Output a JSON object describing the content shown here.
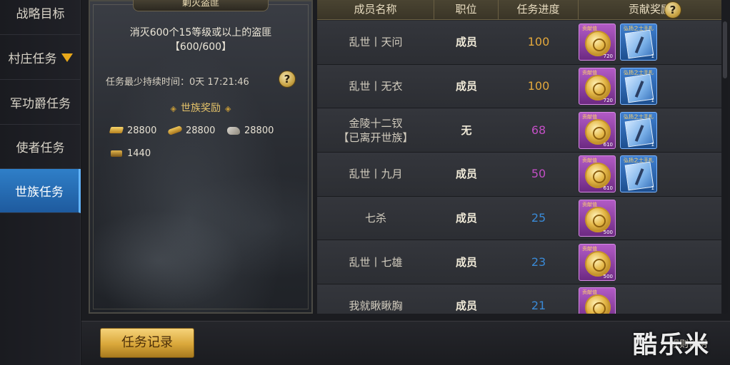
{
  "sidebar": {
    "items": [
      {
        "label": "战略目标",
        "active": false
      },
      {
        "label": "村庄任务",
        "active": false,
        "has_alert": true
      },
      {
        "label": "军功爵任务",
        "active": false
      },
      {
        "label": "使者任务",
        "active": false
      },
      {
        "label": "世族任务",
        "active": true
      }
    ]
  },
  "task": {
    "title": "剿灭盗匪",
    "description": "消灭600个15等级或以上的盗匪",
    "progress": "【600/600】",
    "duration_label": "任务最少持续时间：0天 17:21:46",
    "help_icon": "?",
    "reward_title": "世族奖励",
    "rewards": [
      {
        "icon": "gold-bars-icon",
        "amount": "28800"
      },
      {
        "icon": "wood-icon",
        "amount": "28800"
      },
      {
        "icon": "stone-icon",
        "amount": "28800"
      },
      {
        "icon": "iron-icon",
        "amount": "1440"
      }
    ]
  },
  "table": {
    "headers": [
      "成员名称",
      "职位",
      "任务进度",
      "贡献奖励"
    ],
    "help_icon": "?",
    "rows": [
      {
        "name": "乱世丨天问",
        "position": "成员",
        "progress": "100",
        "progress_color": "#e3a83c",
        "rewards": [
          {
            "type": "coin",
            "tag": "贡献值",
            "qty": "720"
          },
          {
            "type": "book",
            "tag": "弘扬之士手札",
            "qty": "1"
          }
        ]
      },
      {
        "name": "乱世丨无衣",
        "position": "成员",
        "progress": "100",
        "progress_color": "#e3a83c",
        "rewards": [
          {
            "type": "coin",
            "tag": "贡献值",
            "qty": "720"
          },
          {
            "type": "book",
            "tag": "弘扬之士手札",
            "qty": "1"
          }
        ]
      },
      {
        "name": "金陵十二钗\n【已离开世族】",
        "position": "无",
        "progress": "68",
        "progress_color": "#c24fc4",
        "rewards": [
          {
            "type": "coin",
            "tag": "贡献值",
            "qty": "610"
          },
          {
            "type": "book",
            "tag": "弘扬之士手札",
            "qty": "1"
          }
        ]
      },
      {
        "name": "乱世丨九月",
        "position": "成员",
        "progress": "50",
        "progress_color": "#c24fc4",
        "rewards": [
          {
            "type": "coin",
            "tag": "贡献值",
            "qty": "610"
          },
          {
            "type": "book",
            "tag": "弘扬之士手札",
            "qty": "1"
          }
        ]
      },
      {
        "name": "七杀",
        "position": "成员",
        "progress": "25",
        "progress_color": "#3a8ad6",
        "rewards": [
          {
            "type": "coin",
            "tag": "贡献值",
            "qty": "500"
          }
        ]
      },
      {
        "name": "乱世丨七雄",
        "position": "成员",
        "progress": "23",
        "progress_color": "#3a8ad6",
        "rewards": [
          {
            "type": "coin",
            "tag": "贡献值",
            "qty": "500"
          }
        ]
      },
      {
        "name": "我就瞅瞅胸",
        "position": "成员",
        "progress": "21",
        "progress_color": "#3a8ad6",
        "rewards": [
          {
            "type": "coin",
            "tag": "贡献值",
            "qty": ""
          }
        ]
      }
    ]
  },
  "bottom": {
    "record_button": "任务记录",
    "rules_link": "规则说明",
    "watermark": "酷乐米"
  },
  "colors": {
    "active_tab": "#2f7fc8",
    "gold_button": "#d9a73a",
    "progress_gold": "#e3a83c",
    "progress_purple": "#c24fc4",
    "progress_blue": "#3a8ad6"
  }
}
